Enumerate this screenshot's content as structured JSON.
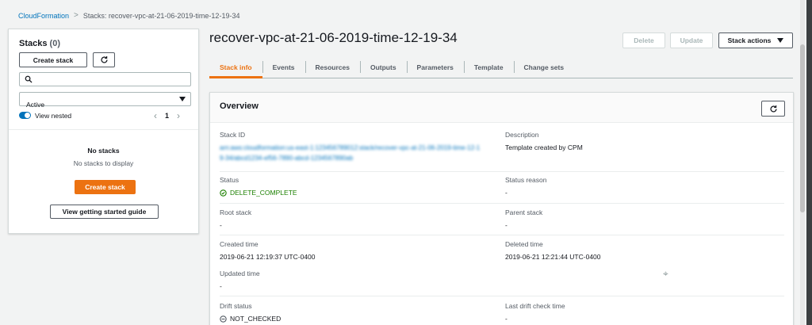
{
  "breadcrumb": {
    "root": "CloudFormation",
    "separator": ">",
    "current": "Stacks: recover-vpc-at-21-06-2019-time-12-19-34"
  },
  "sidebar": {
    "title": "Stacks",
    "count": "(0)",
    "create_label": "Create stack",
    "search_placeholder": "",
    "filter_value": "Active",
    "toggle_label": "View nested",
    "page": "1",
    "empty_title": "No stacks",
    "empty_text": "No stacks to display",
    "empty_create_label": "Create stack",
    "guide_label": "View getting started guide"
  },
  "header": {
    "title": "recover-vpc-at-21-06-2019-time-12-19-34",
    "delete_label": "Delete",
    "update_label": "Update",
    "actions_label": "Stack actions"
  },
  "tabs": [
    {
      "label": "Stack info",
      "active": true
    },
    {
      "label": "Events"
    },
    {
      "label": "Resources"
    },
    {
      "label": "Outputs"
    },
    {
      "label": "Parameters"
    },
    {
      "label": "Template"
    },
    {
      "label": "Change sets"
    }
  ],
  "overview": {
    "title": "Overview",
    "stack_id_label": "Stack ID",
    "stack_id_value": "arn:aws:cloudformation:us-east-1:123456789012:stack/recover-vpc-at-21-06-2019-time-12-19-34/abcd1234-ef56-7890-abcd-1234567890ab",
    "description_label": "Description",
    "description_value": "Template created by CPM",
    "status_label": "Status",
    "status_value": "DELETE_COMPLETE",
    "status_reason_label": "Status reason",
    "status_reason_value": "-",
    "root_stack_label": "Root stack",
    "root_stack_value": "-",
    "parent_stack_label": "Parent stack",
    "parent_stack_value": "-",
    "created_label": "Created time",
    "created_value": "2019-06-21 12:19:37 UTC-0400",
    "deleted_label": "Deleted time",
    "deleted_value": "2019-06-21 12:21:44 UTC-0400",
    "updated_label": "Updated time",
    "updated_value": "-",
    "drift_label": "Drift status",
    "drift_value": "NOT_CHECKED",
    "last_drift_label": "Last drift check time",
    "last_drift_value": "-"
  },
  "colors": {
    "accent": "#ec7211",
    "link": "#0073bb",
    "success": "#1d8102"
  },
  "icons": [
    "chevron-right-icon",
    "refresh-icon",
    "search-icon",
    "caret-down-icon",
    "chevron-left-icon",
    "check-circle-icon",
    "minus-circle-icon",
    "copy-icon"
  ]
}
